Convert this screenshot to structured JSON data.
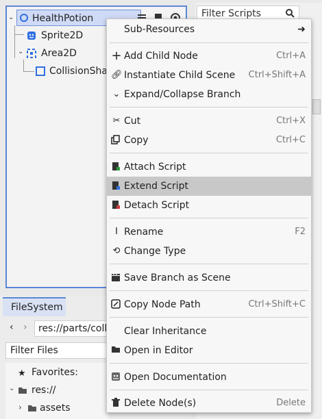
{
  "scene_tree": {
    "nodes": [
      {
        "name": "HealthPotion",
        "icon": "node3d-icon",
        "selected": true
      },
      {
        "name": "Sprite2D",
        "icon": "sprite2d-icon"
      },
      {
        "name": "Area2D",
        "icon": "area2d-icon"
      },
      {
        "name": "CollisionShap",
        "icon": "collisionshape-icon"
      }
    ]
  },
  "scripts_panel": {
    "filter_placeholder": "Filter Scripts"
  },
  "filesystem": {
    "tab_label": "FileSystem",
    "path": "res://parts/colle",
    "filter_placeholder": "Filter Files",
    "items": [
      {
        "label": "Favorites:",
        "icon": "star-icon"
      },
      {
        "label": "res://",
        "icon": "folder-icon"
      },
      {
        "label": "assets",
        "icon": "folder-icon"
      }
    ]
  },
  "context_menu": {
    "sub_resources": "Sub-Resources",
    "add_child_node": {
      "label": "Add Child Node",
      "shortcut": "Ctrl+A"
    },
    "instantiate_child_scene": {
      "label": "Instantiate Child Scene",
      "shortcut": "Ctrl+Shift+A"
    },
    "expand_collapse_branch": {
      "label": "Expand/Collapse Branch"
    },
    "cut": {
      "label": "Cut",
      "shortcut": "Ctrl+X"
    },
    "copy": {
      "label": "Copy",
      "shortcut": "Ctrl+C"
    },
    "attach_script": {
      "label": "Attach Script"
    },
    "extend_script": {
      "label": "Extend Script",
      "highlighted": true
    },
    "detach_script": {
      "label": "Detach Script"
    },
    "rename": {
      "label": "Rename",
      "shortcut": "F2"
    },
    "change_type": {
      "label": "Change Type"
    },
    "save_branch_as_scene": {
      "label": "Save Branch as Scene"
    },
    "copy_node_path": {
      "label": "Copy Node Path",
      "shortcut": "Ctrl+Shift+C"
    },
    "clear_inheritance": {
      "label": "Clear Inheritance"
    },
    "open_in_editor": {
      "label": "Open in Editor"
    },
    "open_documentation": {
      "label": "Open Documentation"
    },
    "delete_nodes": {
      "label": "Delete Node(s)",
      "shortcut": "Delete"
    }
  },
  "colors": {
    "accent": "#5a86d8",
    "node_blue": "#2f6fe0",
    "highlight": "#c8c8c8"
  }
}
